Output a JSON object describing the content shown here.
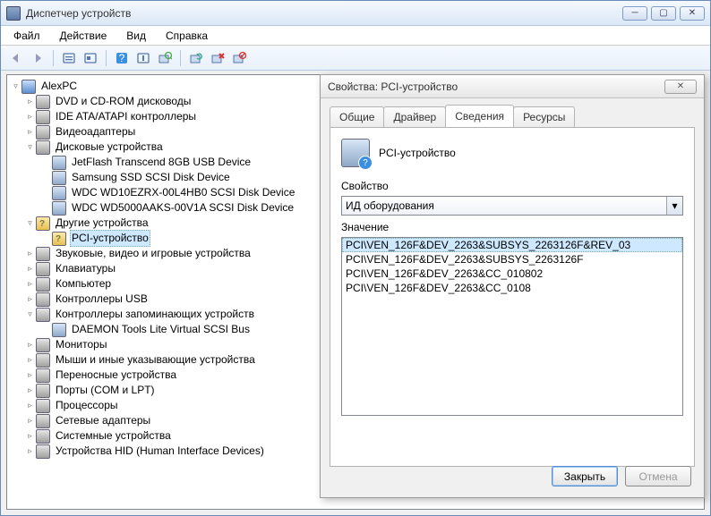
{
  "window": {
    "title": "Диспетчер устройств"
  },
  "menu": {
    "file": "Файл",
    "action": "Действие",
    "view": "Вид",
    "help": "Справка"
  },
  "tree": {
    "root": "AlexPC",
    "cats": {
      "cdrom": "DVD и CD-ROM дисководы",
      "ide": "IDE ATA/ATAPI контроллеры",
      "video": "Видеоадаптеры",
      "disks": "Дисковые устройства",
      "disk_items": [
        "JetFlash Transcend 8GB USB Device",
        "Samsung SSD SCSI Disk Device",
        "WDC WD10EZRX-00L4HB0 SCSI Disk Device",
        "WDC WD5000AAKS-00V1A SCSI Disk Device"
      ],
      "other": "Другие устройства",
      "other_items": [
        "PCI-устройство"
      ],
      "sound": "Звуковые, видео и игровые устройства",
      "keyboard": "Клавиатуры",
      "computer": "Компьютер",
      "usb": "Контроллеры USB",
      "storage_ctl": "Контроллеры запоминающих устройств",
      "storage_ctl_items": [
        "DAEMON Tools Lite Virtual SCSI Bus"
      ],
      "monitors": "Мониторы",
      "mouse": "Мыши и иные указывающие устройства",
      "portable": "Переносные устройства",
      "ports": "Порты (COM и LPT)",
      "cpu": "Процессоры",
      "net": "Сетевые адаптеры",
      "sysdev": "Системные устройства",
      "hid": "Устройства HID (Human Interface Devices)"
    }
  },
  "dialog": {
    "title": "Свойства: PCI-устройство",
    "tabs": {
      "general": "Общие",
      "driver": "Драйвер",
      "details": "Сведения",
      "resources": "Ресурсы"
    },
    "device_name": "PCI-устройство",
    "property_label": "Свойство",
    "property_value": "ИД оборудования",
    "value_label": "Значение",
    "values": [
      "PCI\\VEN_126F&DEV_2263&SUBSYS_2263126F&REV_03",
      "PCI\\VEN_126F&DEV_2263&SUBSYS_2263126F",
      "PCI\\VEN_126F&DEV_2263&CC_010802",
      "PCI\\VEN_126F&DEV_2263&CC_0108"
    ],
    "close": "Закрыть",
    "cancel": "Отмена"
  }
}
